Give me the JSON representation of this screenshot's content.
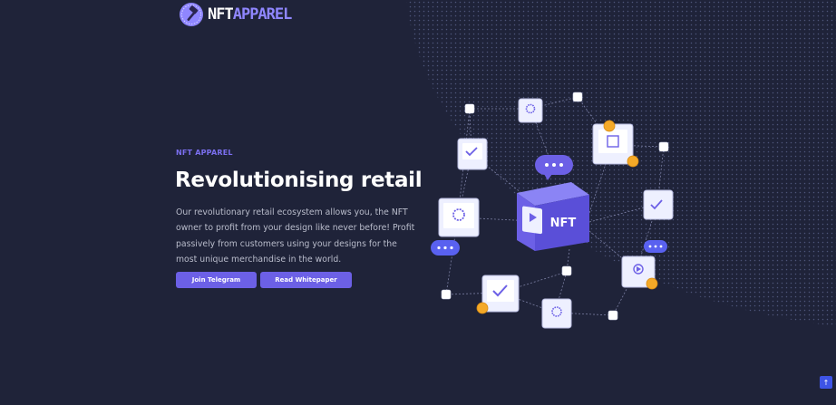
{
  "brand": {
    "name_part1": "NFT",
    "name_part2": "APPAREL",
    "logo_icon": "hammer-icon"
  },
  "hero": {
    "eyebrow": "NFT APPAREL",
    "title": "Revolutionising retail",
    "description": "Our revolutionary retail ecosystem allows you, the NFT owner to profit from your design like never before! Profit passively from customers using your designs for the most unique merchandise in the world.",
    "buttons": {
      "telegram": "Join Telegram",
      "whitepaper": "Read Whitepaper"
    }
  },
  "illustration": {
    "cube_label": "NFT"
  },
  "scroll_top": {
    "label": "↑",
    "icon": "arrow-up-icon"
  },
  "colors": {
    "background": "#1f2339",
    "accent": "#6c60e6",
    "accent_light": "#8f86ff",
    "coin": "#f4a928"
  }
}
